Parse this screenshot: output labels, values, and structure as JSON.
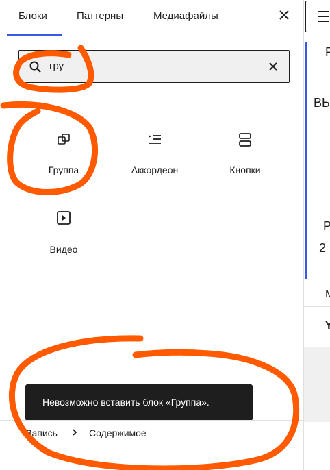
{
  "tabs": [
    {
      "label": "Блоки",
      "active": true
    },
    {
      "label": "Паттерны",
      "active": false
    },
    {
      "label": "Медиафайлы",
      "active": false
    }
  ],
  "search": {
    "value": "гру"
  },
  "blocks": [
    {
      "label": "Группа",
      "icon": "group-icon"
    },
    {
      "label": "Аккордеон",
      "icon": "accordion-icon"
    },
    {
      "label": "Кнопки",
      "icon": "buttons-icon"
    },
    {
      "label": "Видео",
      "icon": "video-icon"
    }
  ],
  "notice": {
    "text": "Невозможно вставить блок «Группа»."
  },
  "breadcrumb": {
    "items": [
      "Запись",
      "Содержимое"
    ]
  },
  "editor_fragments": [
    "Р",
    "ВЬ",
    "Р",
    "2",
    "М",
    "Y"
  ],
  "colors": {
    "accent": "#3858e9",
    "annotation": "#ff5a00",
    "snackbar": "#1e1e1e"
  }
}
